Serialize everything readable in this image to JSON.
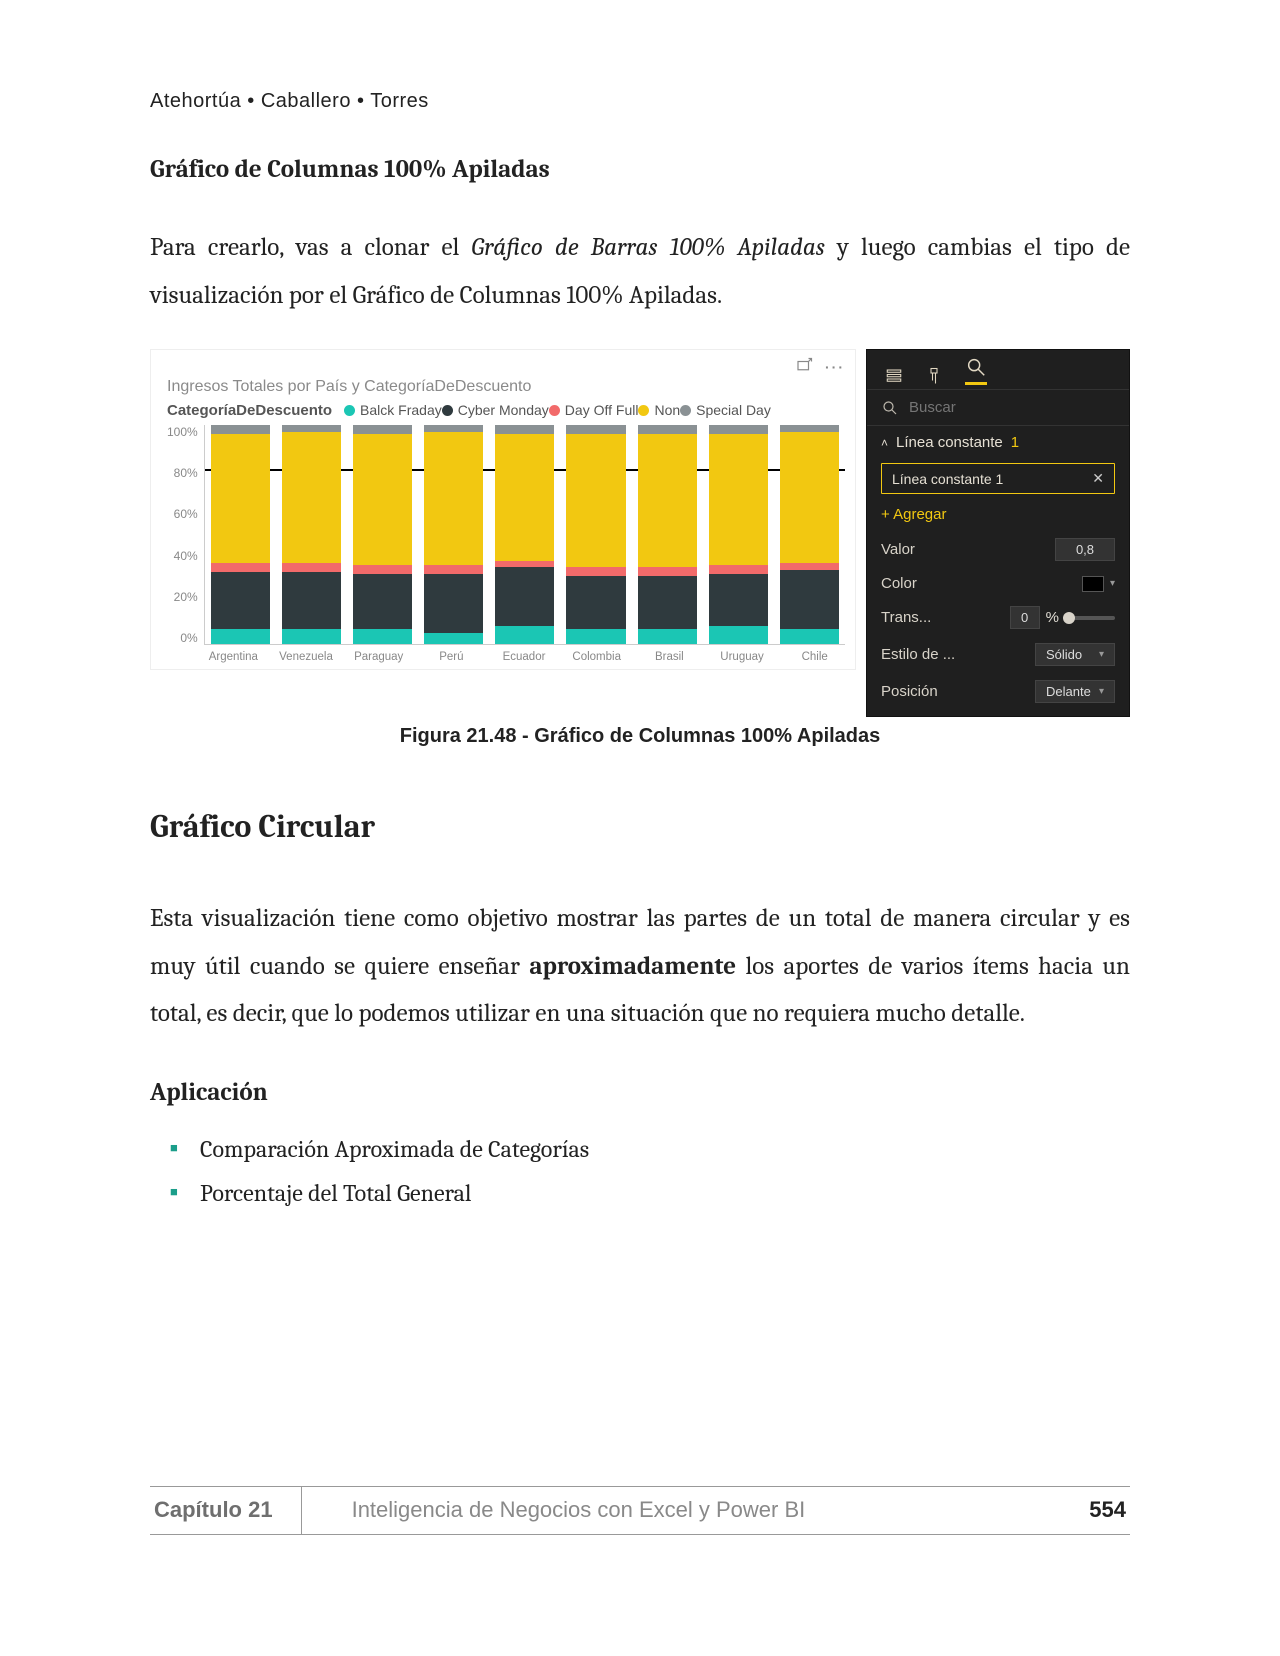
{
  "authors": "Atehortúa • Caballero • Torres",
  "section_sub": "Gráfico de Columnas 100% Apiladas",
  "para1_a": "Para crearlo, vas a clonar el ",
  "para1_ital": "Gráfico de Barras 100% Apiladas",
  "para1_b": " y luego cambias el tipo de visualización por el Gráfico de Columnas 100% Apiladas.",
  "fig_caption": "Figura 21.48 - Gráfico de Columnas 100% Apiladas",
  "section_main": "Gráfico Circular",
  "para2_a": "Esta visualización tiene como objetivo mostrar las partes de un total de manera circular y es muy útil cuando se quiere enseñar ",
  "para2_bold": "aproximadamente",
  "para2_b": " los aportes de varios ítems hacia un total, es decir, que lo podemos utilizar en una situación que no requiera mucho detalle.",
  "subheading": "Aplicación",
  "bullets": [
    "Comparación Aproximada de Categorías",
    "Porcentaje del Total General"
  ],
  "footer": {
    "chapter": "Capítulo 21",
    "book": "Inteligencia de Negocios con Excel y Power BI",
    "page": "554"
  },
  "chart": {
    "title": "Ingresos Totales por País y CategoríaDeDescuento",
    "legend_label": "CategoríaDeDescuento",
    "legend": [
      {
        "name": "Balck Fraday",
        "color": "#1bc6b4"
      },
      {
        "name": "Cyber Monday",
        "color": "#2f3a3e"
      },
      {
        "name": "Day Off Full",
        "color": "#f26a6a"
      },
      {
        "name": "Non",
        "color": "#f2c811"
      },
      {
        "name": "Special Day",
        "color": "#8a9194"
      }
    ],
    "ylabels": [
      "100%",
      "80%",
      "60%",
      "40%",
      "20%",
      "0%"
    ],
    "constant_line_pct": 80
  },
  "chart_data": {
    "type": "bar",
    "stacked": "100%",
    "title": "Ingresos Totales por País y CategoríaDeDescuento",
    "ylabel": "%",
    "ylim": [
      0,
      100
    ],
    "reference_lines": [
      {
        "name": "Línea constante 1",
        "value": 0.8
      }
    ],
    "categories": [
      "Argentina",
      "Venezuela",
      "Paraguay",
      "Perú",
      "Ecuador",
      "Colombia",
      "Brasil",
      "Uruguay",
      "Chile"
    ],
    "series": [
      {
        "name": "Balck Fraday",
        "color": "#1bc6b4",
        "values": [
          7,
          7,
          7,
          5,
          8,
          7,
          7,
          8,
          7
        ]
      },
      {
        "name": "Cyber Monday",
        "color": "#2f3a3e",
        "values": [
          26,
          26,
          25,
          27,
          27,
          24,
          24,
          24,
          27
        ]
      },
      {
        "name": "Day Off Full",
        "color": "#f26a6a",
        "values": [
          4,
          4,
          4,
          4,
          3,
          4,
          4,
          4,
          3
        ]
      },
      {
        "name": "Non",
        "color": "#f2c811",
        "values": [
          59,
          60,
          60,
          61,
          58,
          61,
          61,
          60,
          60
        ]
      },
      {
        "name": "Special Day",
        "color": "#8a9194",
        "values": [
          4,
          3,
          4,
          3,
          4,
          4,
          4,
          4,
          3
        ]
      }
    ]
  },
  "pane": {
    "search_placeholder": "Buscar",
    "section_title": "Línea constante",
    "section_count": "1",
    "selected_item": "Línea constante 1",
    "add_label": "+ Agregar",
    "rows": {
      "valor_label": "Valor",
      "valor_value": "0,8",
      "color_label": "Color",
      "trans_label": "Trans...",
      "trans_value": "0",
      "trans_unit": "%",
      "estilo_label": "Estilo de ...",
      "estilo_value": "Sólido",
      "posicion_label": "Posición",
      "posicion_value": "Delante"
    }
  }
}
